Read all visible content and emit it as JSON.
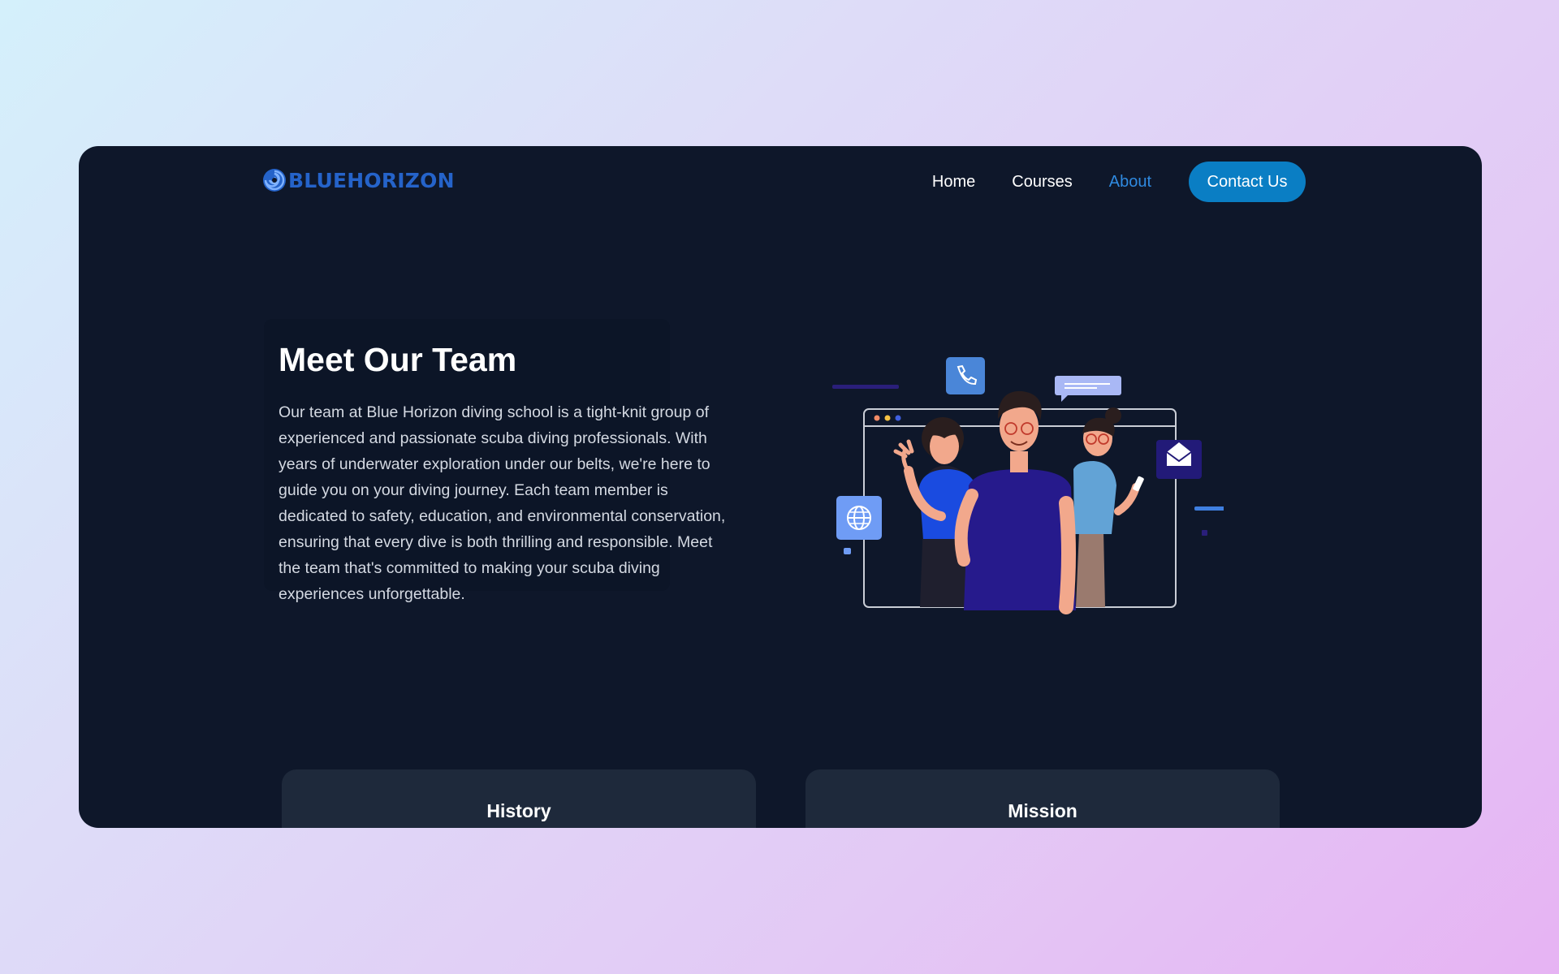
{
  "brand": {
    "name": "BLUEHORIZON",
    "logo_icon": "spiral-logo-icon",
    "color": "#2563c9"
  },
  "nav": {
    "items": [
      {
        "label": "Home",
        "active": false
      },
      {
        "label": "Courses",
        "active": false
      },
      {
        "label": "About",
        "active": true
      }
    ],
    "cta_label": "Contact Us"
  },
  "hero": {
    "title": "Meet Our Team",
    "body": "Our team at Blue Horizon diving school is a tight-knit group of experienced and passionate scuba diving professionals. With years of underwater exploration under our belts, we're here to guide you on your diving journey. Each team member is dedicated to safety, education, and environmental conservation, ensuring that every dive is both thrilling and responsible. Meet the team that's committed to making your scuba diving experiences unforgettable."
  },
  "illustration": {
    "icons": [
      "phone-icon",
      "chat-bubble-icon",
      "envelope-icon",
      "globe-icon"
    ]
  },
  "cards": [
    {
      "title": "History"
    },
    {
      "title": "Mission"
    }
  ],
  "colors": {
    "background": "#0e172a",
    "accent": "#0a7ec4",
    "active_link": "#2f8ae0",
    "card": "#1e293b"
  }
}
